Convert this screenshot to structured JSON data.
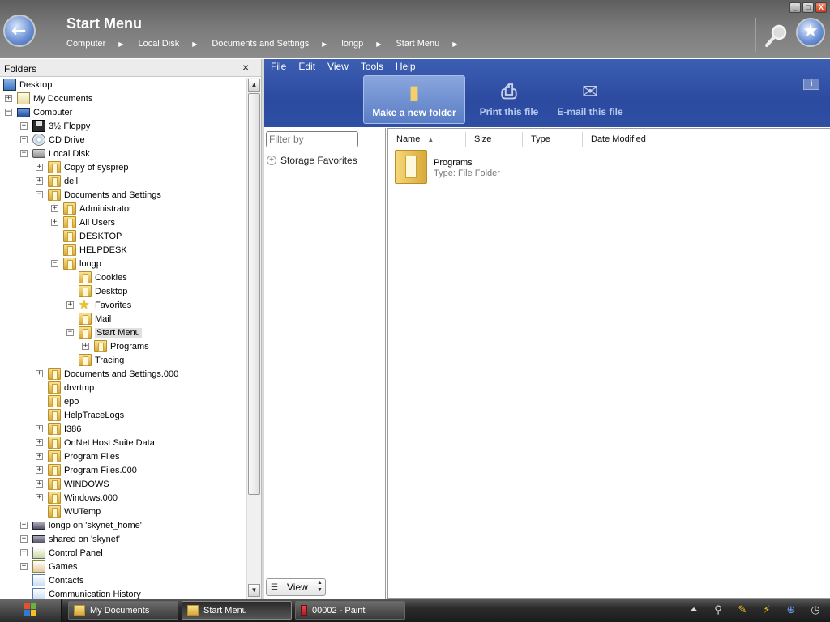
{
  "window": {
    "title": "Start Menu",
    "breadcrumbs": [
      "Computer",
      "Local Disk",
      "Documents and Settings",
      "longp",
      "Start Menu"
    ],
    "controls": {
      "minimize": "_",
      "maximize": "□",
      "close": "X"
    }
  },
  "folders_pane": {
    "header": "Folders",
    "close": "×",
    "tree": [
      {
        "label": "Desktop",
        "icon": "desktop-icon",
        "level": 0,
        "expander": ""
      },
      {
        "label": "My Documents",
        "icon": "my-documents-icon",
        "level": 1,
        "expander": "+"
      },
      {
        "label": "Computer",
        "icon": "computer-icon",
        "level": 1,
        "expander": "-"
      },
      {
        "label": "3½ Floppy",
        "icon": "floppy-icon",
        "level": 2,
        "expander": "+"
      },
      {
        "label": "CD Drive",
        "icon": "cd-drive-icon",
        "level": 2,
        "expander": "+"
      },
      {
        "label": "Local Disk",
        "icon": "drive-icon",
        "level": 2,
        "expander": "-"
      },
      {
        "label": "Copy of sysprep",
        "icon": "folder-icon",
        "level": 3,
        "expander": "+"
      },
      {
        "label": "dell",
        "icon": "folder-icon",
        "level": 3,
        "expander": "+"
      },
      {
        "label": "Documents and Settings",
        "icon": "folder-icon",
        "level": 3,
        "expander": "-"
      },
      {
        "label": "Administrator",
        "icon": "folder-icon",
        "level": 4,
        "expander": "+"
      },
      {
        "label": "All Users",
        "icon": "folder-icon",
        "level": 4,
        "expander": "+"
      },
      {
        "label": "DESKTOP",
        "icon": "folder-icon",
        "level": 4,
        "expander": ""
      },
      {
        "label": "HELPDESK",
        "icon": "folder-icon",
        "level": 4,
        "expander": ""
      },
      {
        "label": "longp",
        "icon": "folder-icon",
        "level": 4,
        "expander": "-"
      },
      {
        "label": "Cookies",
        "icon": "folder-icon",
        "level": 5,
        "expander": ""
      },
      {
        "label": "Desktop",
        "icon": "folder-icon",
        "level": 5,
        "expander": ""
      },
      {
        "label": "Favorites",
        "icon": "star-icon",
        "level": 5,
        "expander": "+"
      },
      {
        "label": "Mail",
        "icon": "folder-icon",
        "level": 5,
        "expander": ""
      },
      {
        "label": "Start Menu",
        "icon": "folder-icon",
        "level": 5,
        "expander": "-",
        "selected": true
      },
      {
        "label": "Programs",
        "icon": "folder-icon",
        "level": 6,
        "expander": "+"
      },
      {
        "label": "Tracing",
        "icon": "folder-icon",
        "level": 5,
        "expander": ""
      },
      {
        "label": "Documents and Settings.000",
        "icon": "folder-icon",
        "level": 3,
        "expander": "+"
      },
      {
        "label": "drvrtmp",
        "icon": "folder-icon",
        "level": 3,
        "expander": ""
      },
      {
        "label": "epo",
        "icon": "folder-icon",
        "level": 3,
        "expander": ""
      },
      {
        "label": "HelpTraceLogs",
        "icon": "folder-icon",
        "level": 3,
        "expander": ""
      },
      {
        "label": "I386",
        "icon": "folder-icon",
        "level": 3,
        "expander": "+"
      },
      {
        "label": "OnNet Host Suite Data",
        "icon": "folder-icon",
        "level": 3,
        "expander": "+"
      },
      {
        "label": "Program Files",
        "icon": "folder-icon",
        "level": 3,
        "expander": "+"
      },
      {
        "label": "Program Files.000",
        "icon": "folder-icon",
        "level": 3,
        "expander": "+"
      },
      {
        "label": "WINDOWS",
        "icon": "folder-icon",
        "level": 3,
        "expander": "+"
      },
      {
        "label": "Windows.000",
        "icon": "folder-icon",
        "level": 3,
        "expander": "+"
      },
      {
        "label": "WUTemp",
        "icon": "folder-icon",
        "level": 3,
        "expander": ""
      },
      {
        "label": "longp on 'skynet_home'",
        "icon": "network-drive-icon",
        "level": 2,
        "expander": "+"
      },
      {
        "label": "shared on 'skynet'",
        "icon": "network-drive-icon",
        "level": 2,
        "expander": "+"
      },
      {
        "label": "Control Panel",
        "icon": "control-panel-icon",
        "level": 2,
        "expander": "+"
      },
      {
        "label": "Games",
        "icon": "games-icon",
        "level": 2,
        "expander": "+"
      },
      {
        "label": "Contacts",
        "icon": "contacts-icon",
        "level": 2,
        "expander": ""
      },
      {
        "label": "Communication History",
        "icon": "contacts-icon",
        "level": 2,
        "expander": ""
      }
    ]
  },
  "menu": [
    "File",
    "Edit",
    "View",
    "Tools",
    "Help"
  ],
  "tasks": [
    {
      "label": "Make a new folder",
      "icon": "new-folder-icon",
      "active": true
    },
    {
      "label": "Print this file",
      "icon": "printer-icon",
      "active": false
    },
    {
      "label": "E-mail this file",
      "icon": "email-icon",
      "active": false
    }
  ],
  "filter": {
    "placeholder": "Filter by",
    "storage_favorites": "Storage Favorites",
    "view_label": "View"
  },
  "file_list": {
    "columns": [
      "Name",
      "Size",
      "Type",
      "Date Modified"
    ],
    "items": [
      {
        "name": "Programs",
        "type_line": "Type: File Folder"
      }
    ]
  },
  "taskbar": {
    "buttons": [
      {
        "label": "My Documents",
        "icon": "folder-icon",
        "active": false
      },
      {
        "label": "Start Menu",
        "icon": "folder-icon",
        "active": true
      },
      {
        "label": "00002 - Paint",
        "icon": "paint-icon",
        "active": false
      }
    ]
  },
  "colors": {
    "titlebar": "#7c7c7c",
    "command_bar": "#2b4aa0",
    "taskbar": "#1a1a1a"
  }
}
